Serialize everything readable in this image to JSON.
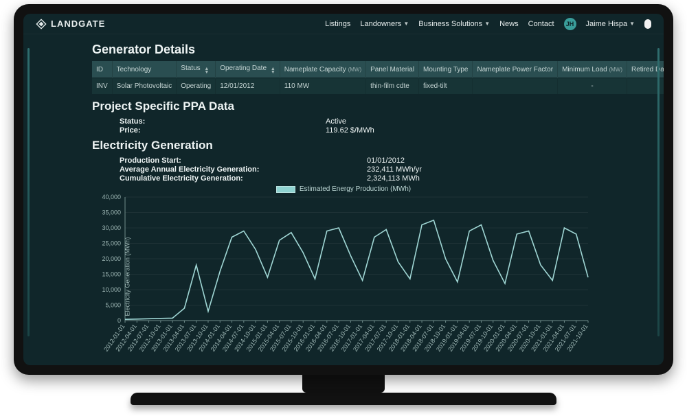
{
  "brand": {
    "name": "LANDGATE"
  },
  "nav": {
    "listings": "Listings",
    "landowners": "Landowners",
    "business": "Business Solutions",
    "news": "News",
    "contact": "Contact",
    "user_initials": "JH",
    "user_name": "Jaime Hispa"
  },
  "sections": {
    "generator_details": "Generator Details",
    "ppa": "Project Specific PPA Data",
    "electricity": "Electricity Generation"
  },
  "table": {
    "headers": {
      "id": "ID",
      "technology": "Technology",
      "status": "Status",
      "operating_date": "Operating Date",
      "nameplate_capacity": "Nameplate Capacity",
      "mw_suffix": "(MW)",
      "panel_material": "Panel Material",
      "mounting_type": "Mounting Type",
      "nameplate_pf": "Nameplate Power Factor",
      "min_load": "Minimum Load",
      "retired_date": "Retired Date"
    },
    "row": {
      "id": "INV",
      "technology": "Solar Photovoltaic",
      "status": "Operating",
      "operating_date": "12/01/2012",
      "nameplate_capacity": "110 MW",
      "panel_material": "thin-film cdte",
      "mounting_type": "fixed-tilt",
      "nameplate_pf": "",
      "min_load": "-",
      "retired_date": ""
    }
  },
  "ppa": {
    "status_label": "Status:",
    "status_value": "Active",
    "price_label": "Price:",
    "price_value": "119.62 $/MWh"
  },
  "electricity": {
    "prod_start_label": "Production Start:",
    "prod_start_value": "01/01/2012",
    "avg_label": "Average Annual Electricity Generation:",
    "avg_value": "232,411 MWh/yr",
    "cum_label": "Cumulative Electricity Generation:",
    "cum_value": "2,324,113 MWh"
  },
  "legend": {
    "label": "Estimated Energy Production (MWh)"
  },
  "chart": {
    "ylabel": "Electricity Generation (MWh)"
  },
  "chart_data": {
    "type": "line",
    "title": "",
    "xlabel": "",
    "ylabel": "Electricity Generation (MWh)",
    "ylim": [
      0,
      40000
    ],
    "yticks": [
      0,
      5000,
      10000,
      15000,
      20000,
      25000,
      30000,
      35000,
      40000
    ],
    "ytick_labels": [
      "0",
      "5,000",
      "10,000",
      "15,000",
      "20,000",
      "25,000",
      "30,000",
      "35,000",
      "40,000"
    ],
    "x": [
      "2012-01-01",
      "2012-04-01",
      "2012-07-01",
      "2012-10-01",
      "2013-01-01",
      "2013-04-01",
      "2013-07-01",
      "2013-10-01",
      "2014-01-01",
      "2014-04-01",
      "2014-07-01",
      "2014-10-01",
      "2015-01-01",
      "2015-04-01",
      "2015-07-01",
      "2015-10-01",
      "2016-01-01",
      "2016-04-01",
      "2016-07-01",
      "2016-10-01",
      "2017-01-01",
      "2017-04-01",
      "2017-07-01",
      "2017-10-01",
      "2018-01-01",
      "2018-04-01",
      "2018-07-01",
      "2018-10-01",
      "2019-01-01",
      "2019-04-01",
      "2019-07-01",
      "2019-10-01",
      "2020-01-01",
      "2020-04-01",
      "2020-07-01",
      "2020-10-01",
      "2021-01-01",
      "2021-04-01",
      "2021-07-01",
      "2021-10-01"
    ],
    "legend": [
      "Estimated Energy Production (MWh)"
    ],
    "series": [
      {
        "name": "Estimated Energy Production (MWh)",
        "values": [
          400,
          500,
          600,
          700,
          800,
          4000,
          18000,
          3000,
          16000,
          27000,
          29000,
          23000,
          14000,
          26000,
          28500,
          22000,
          13500,
          29000,
          30000,
          21000,
          13000,
          27000,
          29500,
          19000,
          13500,
          31000,
          32500,
          20000,
          12500,
          29000,
          31000,
          19500,
          12000,
          28000,
          29000,
          18000,
          13000,
          30000,
          28000,
          14000
        ]
      }
    ]
  }
}
